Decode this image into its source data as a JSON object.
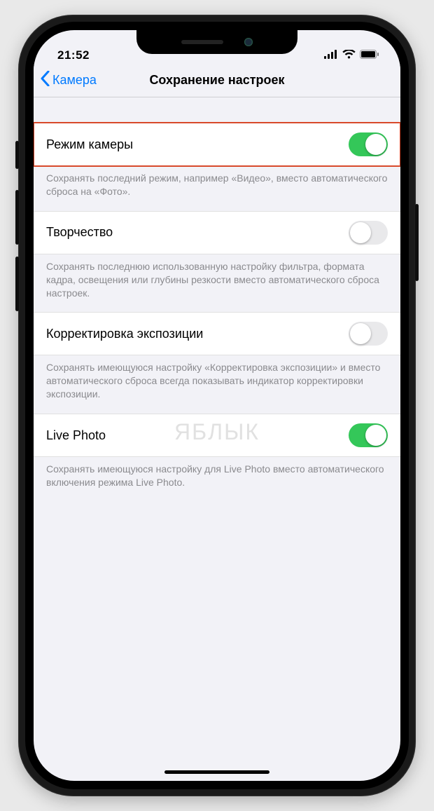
{
  "status": {
    "time": "21:52"
  },
  "nav": {
    "back_label": "Камера",
    "title": "Сохранение настроек"
  },
  "settings": [
    {
      "label": "Режим камеры",
      "enabled": true,
      "highlighted": true,
      "footer": "Сохранять последний режим, например «Видео», вместо автоматического сброса на «Фото»."
    },
    {
      "label": "Творчество",
      "enabled": false,
      "highlighted": false,
      "footer": "Сохранять последнюю использованную настройку фильтра, формата кадра, освещения или глубины резкости вместо автоматического сброса настроек."
    },
    {
      "label": "Корректировка экспозиции",
      "enabled": false,
      "highlighted": false,
      "footer": "Сохранять имеющуюся настройку «Корректировка экспозиции» и вместо автоматического сброса всегда показывать индикатор корректировки экспозиции."
    },
    {
      "label": "Live Photo",
      "enabled": true,
      "highlighted": false,
      "footer": "Сохранять имеющуюся настройку для Live Photo вместо автоматического включения режима Live Photo."
    }
  ],
  "watermark": "ЯБЛЫК"
}
